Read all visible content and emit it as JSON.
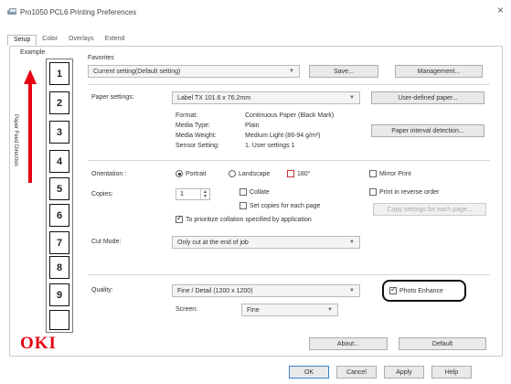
{
  "window": {
    "title": "Pro1050 PCL6 Printing Preferences",
    "close": "×"
  },
  "tabs": [
    "Setup",
    "Color",
    "Overlays",
    "Extend"
  ],
  "example": {
    "label": "Example",
    "feed_direction": "Paper Feed Direction",
    "labels": [
      "1",
      "2",
      "3",
      "4",
      "5",
      "6",
      "7",
      "8",
      "9"
    ],
    "arrow_color": "#e60012"
  },
  "favorites": {
    "group_label": "Favorites",
    "value": "Current setting(Default setting)",
    "save_label": "Save...",
    "management_label": "Management..."
  },
  "paper": {
    "label": "Paper settings:",
    "value": "Label TX 101.6 x 76.2mm",
    "user_defined_label": "User-defined paper...",
    "interval_detection_label": "Paper interval detection...",
    "details": [
      {
        "key": "Format:",
        "value": "Continuous Paper (Black Mark)"
      },
      {
        "key": "Media Type:",
        "value": "Plain"
      },
      {
        "key": "Media Weight:",
        "value": "Medium Light (86-94 g/m²)"
      },
      {
        "key": "Sensor Setting:",
        "value": "1. User settings 1"
      }
    ]
  },
  "orientation": {
    "label": "Orientation :",
    "portrait": "Portrait",
    "landscape": "Landscape",
    "rotate_180": "180°",
    "mirror_print": "Mirror Print"
  },
  "copies": {
    "label": "Copies:",
    "value": "1",
    "collate": "Collate",
    "set_copies_each_page": "Set copies for each page",
    "prioritize": "To prioritize collation specified by application",
    "print_reverse": "Print in reverse order",
    "copy_settings_label": "Copy settings for each page..."
  },
  "cut_mode": {
    "label": "Cut Mode:",
    "value": "Only cut at the end of job"
  },
  "quality": {
    "label": "Quality:",
    "value": "Fine / Detail (1200 x 1200)",
    "screen_label": "Screen:",
    "screen_value": "Fine",
    "photo_enhance": "Photo Enhance"
  },
  "brand": {
    "logo_text": "OKI",
    "color": "#e60012"
  },
  "footer": {
    "about_label": "About...",
    "default_label": "Default",
    "ok_label": "OK",
    "cancel_label": "Cancel",
    "apply_label": "Apply",
    "help_label": "Help"
  }
}
